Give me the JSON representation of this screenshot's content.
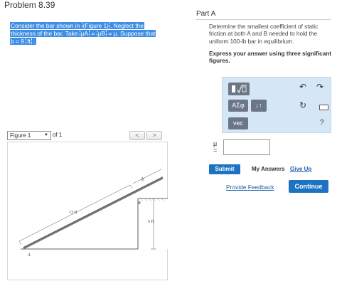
{
  "problem": {
    "title": "Problem 8.39",
    "text_line1": "Consider the bar shown in",
    "figure_link": "(Figure 1)",
    "text_line1b": ". Neglect the",
    "text_line2a": "thickness of the bar. Take ",
    "mu_a": "μA",
    "eq1": " = ",
    "mu_b": "μB",
    "eq2": " = μ. Suppose that",
    "text_line3a": "b = 9 ",
    "unit_ft": "ft",
    "text_line3b": " ."
  },
  "figure": {
    "selector_value": "Figure 1",
    "of_text": "of 1",
    "prev_label": "<",
    "next_label": ">",
    "label_b": "b",
    "label_B": "B",
    "label_A": "A",
    "label_13ft": "13 ft",
    "label_5ft": "5 ft"
  },
  "part": {
    "title": "Part A",
    "description": "Determine the smallest coefficient of static friction at both A and B needed to hold the uniform 100-lb bar in equilibrium.",
    "instruction": "Express your answer using three significant figures."
  },
  "toolbar": {
    "symbols_label": "ΑΣφ",
    "arrows_label": "↓↑",
    "vec_label": "vec",
    "help_label": "?"
  },
  "answer": {
    "variable": "μ",
    "equals": "=",
    "value": ""
  },
  "actions": {
    "submit": "Submit",
    "my_answers": "My Answers",
    "give_up": "Give Up",
    "feedback": "Provide Feedback",
    "continue": "Continue"
  }
}
